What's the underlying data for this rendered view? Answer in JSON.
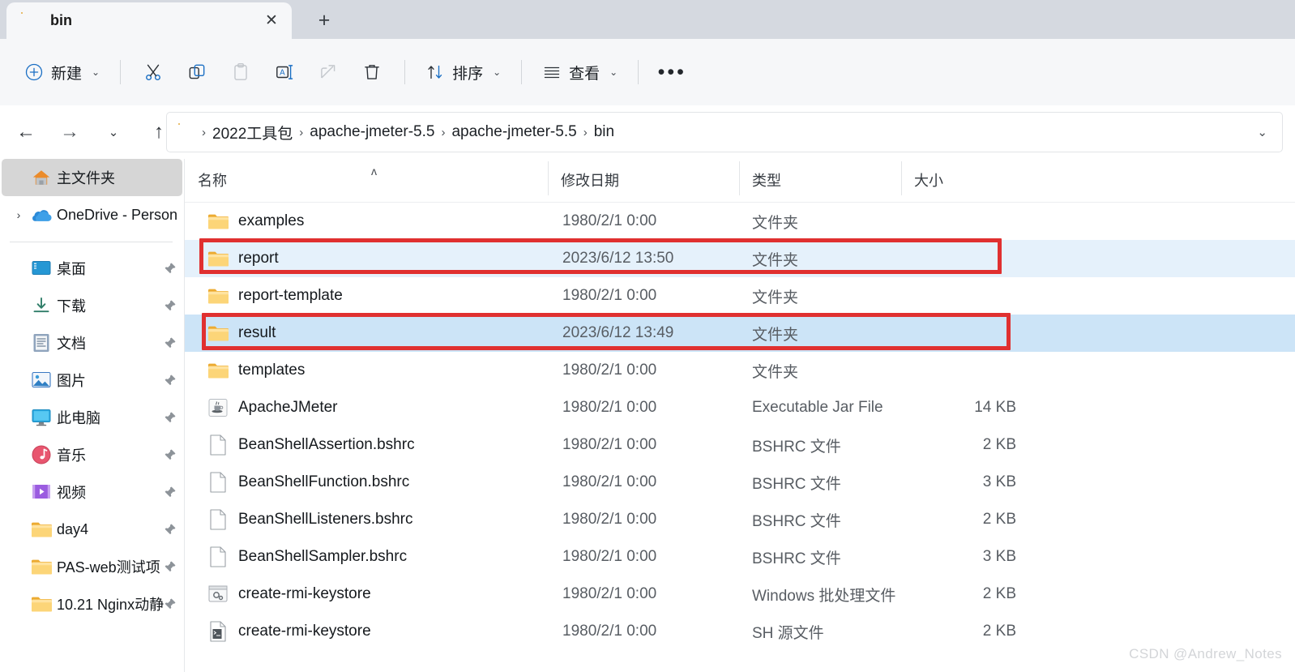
{
  "window": {
    "tab": {
      "title": "bin",
      "icon": "folder-icon",
      "close_label": "✕"
    },
    "new_tab_label": "+"
  },
  "toolbar": {
    "new_label": "新建",
    "chevron": "⌄",
    "items": [
      {
        "name": "cut",
        "icon": "scissors-icon"
      },
      {
        "name": "copy",
        "icon": "copy-icon"
      },
      {
        "name": "paste",
        "icon": "paste-icon"
      },
      {
        "name": "rename",
        "icon": "rename-icon"
      },
      {
        "name": "share",
        "icon": "share-icon"
      },
      {
        "name": "delete",
        "icon": "trash-icon"
      }
    ],
    "sort_label": "排序",
    "view_label": "查看",
    "more_label": "•••"
  },
  "address": {
    "back": "←",
    "forward": "→",
    "recent": "⌄",
    "up": "↑",
    "dropdown": "⌄",
    "separator": "›",
    "crumbs": [
      "2022工具包",
      "apache-jmeter-5.5",
      "apache-jmeter-5.5",
      "bin"
    ]
  },
  "sidebar": {
    "items": [
      {
        "label": "主文件夹",
        "icon": "home-icon",
        "selected": true,
        "expandable": false,
        "pinned": false
      },
      {
        "label": "OneDrive - Person",
        "icon": "onedrive-icon",
        "selected": false,
        "expandable": true,
        "pinned": false
      },
      {
        "divider": true
      },
      {
        "label": "桌面",
        "icon": "desktop-icon",
        "selected": false,
        "expandable": false,
        "pinned": true
      },
      {
        "label": "下载",
        "icon": "downloads-icon",
        "selected": false,
        "expandable": false,
        "pinned": true
      },
      {
        "label": "文档",
        "icon": "documents-icon",
        "selected": false,
        "expandable": false,
        "pinned": true
      },
      {
        "label": "图片",
        "icon": "pictures-icon",
        "selected": false,
        "expandable": false,
        "pinned": true
      },
      {
        "label": "此电脑",
        "icon": "this-pc-icon",
        "selected": false,
        "expandable": false,
        "pinned": true
      },
      {
        "label": "音乐",
        "icon": "music-icon",
        "selected": false,
        "expandable": false,
        "pinned": true
      },
      {
        "label": "视频",
        "icon": "videos-icon",
        "selected": false,
        "expandable": false,
        "pinned": true
      },
      {
        "label": "day4",
        "icon": "folder-icon",
        "selected": false,
        "expandable": false,
        "pinned": true
      },
      {
        "label": "PAS-web测试项",
        "icon": "folder-icon",
        "selected": false,
        "expandable": false,
        "pinned": true
      },
      {
        "label": "10.21 Nginx动静",
        "icon": "folder-icon",
        "selected": false,
        "expandable": false,
        "pinned": true
      }
    ]
  },
  "filelist": {
    "columns": {
      "name": "名称",
      "date": "修改日期",
      "type": "类型",
      "size": "大小"
    },
    "sort_indicator": "ʌ",
    "rows": [
      {
        "name": "examples",
        "date": "1980/2/1 0:00",
        "type": "文件夹",
        "size": "",
        "icon": "folder-icon",
        "state": "normal"
      },
      {
        "name": "report",
        "date": "2023/6/12 13:50",
        "type": "文件夹",
        "size": "",
        "icon": "folder-icon",
        "state": "sel-light"
      },
      {
        "name": "report-template",
        "date": "1980/2/1 0:00",
        "type": "文件夹",
        "size": "",
        "icon": "folder-icon",
        "state": "normal"
      },
      {
        "name": "result",
        "date": "2023/6/12 13:49",
        "type": "文件夹",
        "size": "",
        "icon": "folder-icon",
        "state": "sel-strong"
      },
      {
        "name": "templates",
        "date": "1980/2/1 0:00",
        "type": "文件夹",
        "size": "",
        "icon": "folder-icon",
        "state": "normal"
      },
      {
        "name": "ApacheJMeter",
        "date": "1980/2/1 0:00",
        "type": "Executable Jar File",
        "size": "14 KB",
        "icon": "jar-icon",
        "state": "normal"
      },
      {
        "name": "BeanShellAssertion.bshrc",
        "date": "1980/2/1 0:00",
        "type": "BSHRC 文件",
        "size": "2 KB",
        "icon": "file-icon",
        "state": "normal"
      },
      {
        "name": "BeanShellFunction.bshrc",
        "date": "1980/2/1 0:00",
        "type": "BSHRC 文件",
        "size": "3 KB",
        "icon": "file-icon",
        "state": "normal"
      },
      {
        "name": "BeanShellListeners.bshrc",
        "date": "1980/2/1 0:00",
        "type": "BSHRC 文件",
        "size": "2 KB",
        "icon": "file-icon",
        "state": "normal"
      },
      {
        "name": "BeanShellSampler.bshrc",
        "date": "1980/2/1 0:00",
        "type": "BSHRC 文件",
        "size": "3 KB",
        "icon": "file-icon",
        "state": "normal"
      },
      {
        "name": "create-rmi-keystore",
        "date": "1980/2/1 0:00",
        "type": "Windows 批处理文件",
        "size": "2 KB",
        "icon": "bat-icon",
        "state": "normal"
      },
      {
        "name": "create-rmi-keystore",
        "date": "1980/2/1 0:00",
        "type": "SH 源文件",
        "size": "2 KB",
        "icon": "sh-icon",
        "state": "normal"
      }
    ]
  },
  "annotations": {
    "highlight_color": "#e03030",
    "boxes": [
      "report",
      "result"
    ]
  },
  "watermark": "CSDN @Andrew_Notes"
}
